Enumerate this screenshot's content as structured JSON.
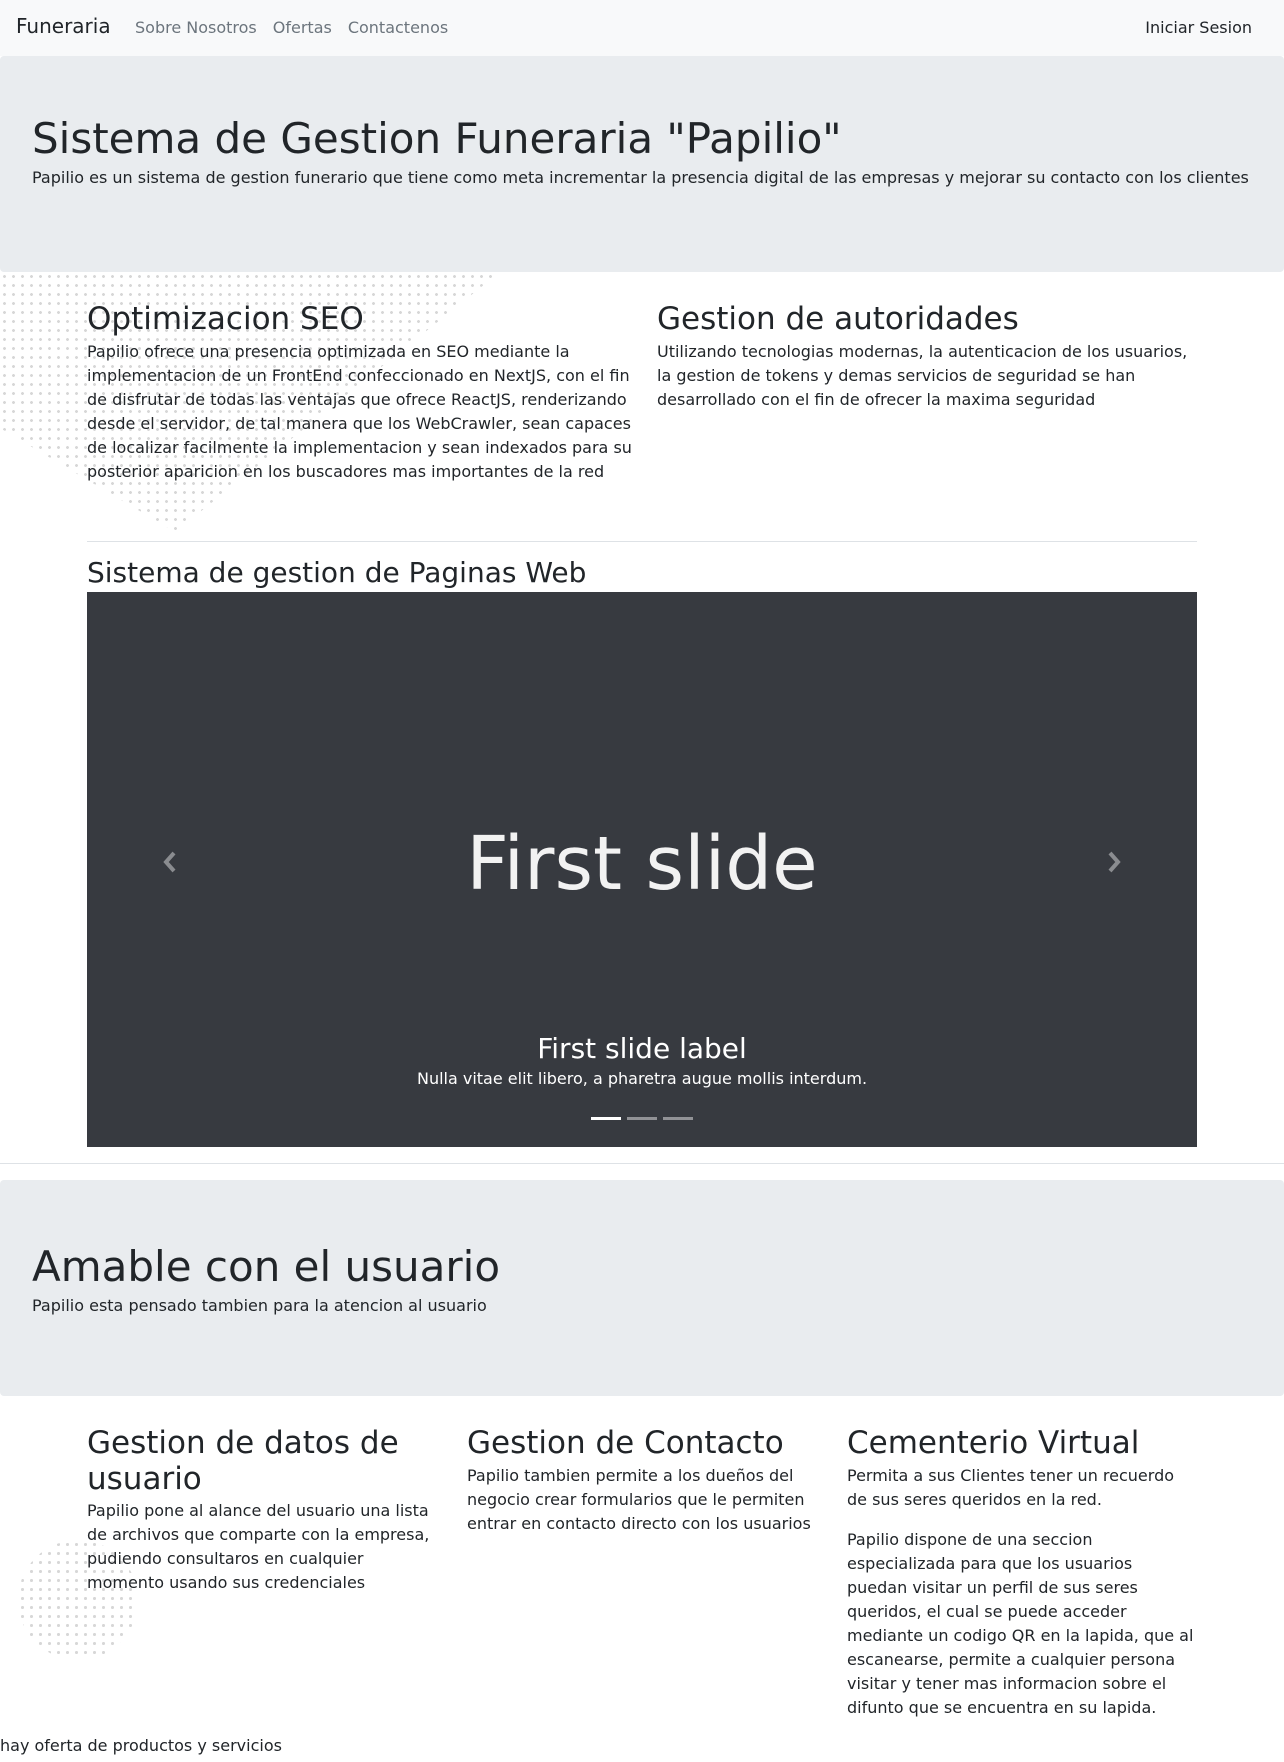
{
  "navbar": {
    "brand": "Funeraria",
    "links": [
      "Sobre Nosotros",
      "Ofertas",
      "Contactenos"
    ],
    "login": "Iniciar Sesion"
  },
  "hero": {
    "title": "Sistema de Gestion Funeraria \"Papilio\"",
    "subtitle": "Papilio es un sistema de gestion funerario que tiene como meta incrementar la presencia digital de las empresas y mejorar su contacto con los clientes"
  },
  "features": {
    "seo": {
      "title": "Optimizacion SEO",
      "text": "Papilio ofrece una presencia optimizada en SEO mediante la implementacion de un FrontEnd confeccionado en NextJS, con el fin de disfrutar de todas las ventajas que ofrece ReactJS, renderizando desde el servidor, de tal manera que los WebCrawler, sean capaces de localizar facilmente la implementacion y sean indexados para su posterior aparicion en los buscadores mas importantes de la red"
    },
    "auth": {
      "title": "Gestion de autoridades",
      "text": "Utilizando tecnologias modernas, la autenticacion de los usuarios, la gestion de tokens y demas servicios de seguridad se han desarrollado con el fin de ofrecer la maxima seguridad"
    }
  },
  "web_section": {
    "title": "Sistema de gestion de Paginas Web"
  },
  "carousel": {
    "slide_text": "First slide",
    "caption_title": "First slide label",
    "caption_text": "Nulla vitae elit libero, a pharetra augue mollis interdum.",
    "prev_icon": "chevron-left-icon",
    "next_icon": "chevron-right-icon",
    "indicator_count": 3,
    "active_index": 0
  },
  "hero2": {
    "title": "Amable con el usuario",
    "subtitle": "Papilio esta pensado tambien para la atencion al usuario"
  },
  "columns": {
    "datos": {
      "title": "Gestion de datos de usuario",
      "text": "Papilio pone al alance del usuario una lista de archivos que comparte con la empresa, pudiendo consultaros en cualquier momento usando sus credenciales"
    },
    "contacto": {
      "title": "Gestion de Contacto",
      "text": "Papilio tambien permite a los dueños del negocio crear formularios que le permiten entrar en contacto directo con los usuarios"
    },
    "cementerio": {
      "title": "Cementerio Virtual",
      "text1": "Permita a sus Clientes tener un recuerdo de sus seres queridos en la red.",
      "text2": "Papilio dispone de una seccion especializada para que los usuarios puedan visitar un perfil de sus seres queridos, el cual se puede acceder mediante un codigo QR en la lapida, que al escanearse, permite a cualquier persona visitar y tener mas informacion sobre el difunto que se encuentra en su lapida."
    }
  },
  "footer_note": "hay oferta de productos y servicios",
  "colors": {
    "navbar_bg": "#f8f9fa",
    "jumbotron_bg": "#e9ecef",
    "carousel_bg": "#373a40",
    "text": "#212529",
    "muted": "#6c757d"
  }
}
